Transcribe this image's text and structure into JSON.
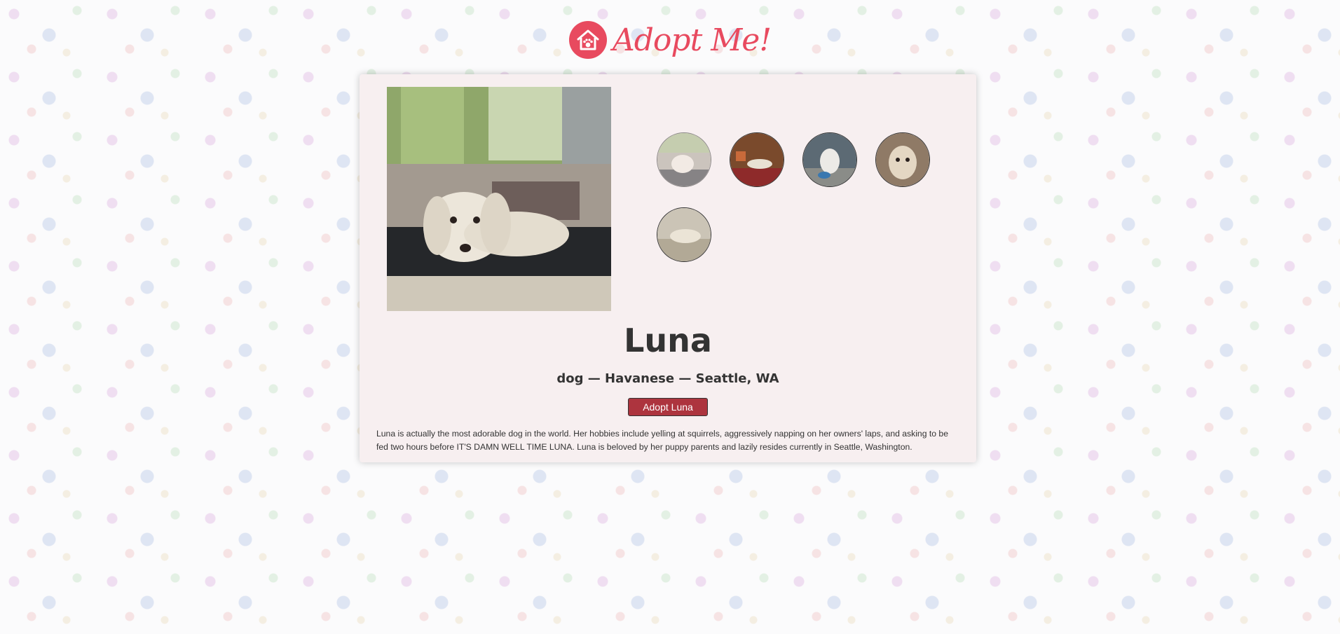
{
  "header": {
    "logo_text": "Adopt Me!",
    "logo_icon": "house-paw-icon",
    "accent_color": "#e84a5f"
  },
  "pet": {
    "name": "Luna",
    "subtitle": "dog — Havanese — Seattle, WA",
    "adopt_label": "Adopt Luna",
    "description": "Luna is actually the most adorable dog in the world. Her hobbies include yelling at squirrels, aggressively napping on her owners' laps, and asking to be fed two hours before IT'S DAMN WELL TIME LUNA. Luna is beloved by her puppy parents and lazily resides currently in Seattle, Washington."
  },
  "colors": {
    "card_bg": "#f7eff0",
    "button_bg": "#ad343e",
    "text": "#333333"
  }
}
